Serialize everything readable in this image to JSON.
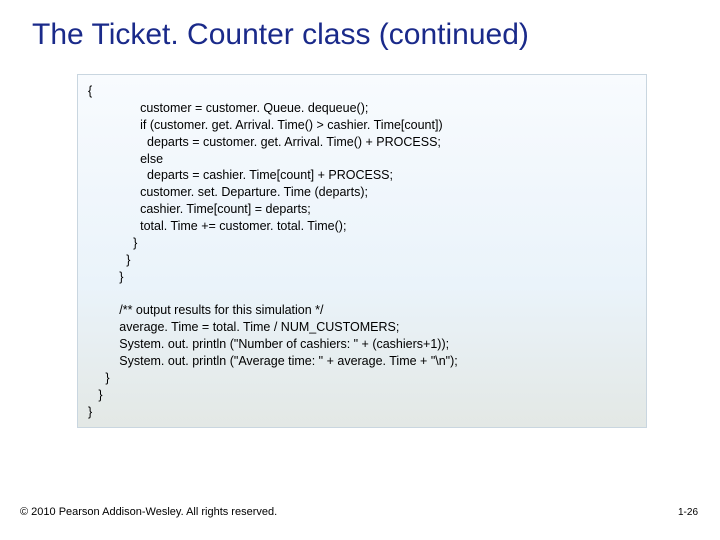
{
  "title": "The Ticket. Counter class (continued)",
  "code": {
    "lines": [
      "{",
      "               customer = customer. Queue. dequeue();",
      "               if (customer. get. Arrival. Time() > cashier. Time[count])",
      "                 departs = customer. get. Arrival. Time() + PROCESS;",
      "               else",
      "                 departs = cashier. Time[count] + PROCESS;",
      "               customer. set. Departure. Time (departs);",
      "               cashier. Time[count] = departs;",
      "               total. Time += customer. total. Time();",
      "             }",
      "           }",
      "         }",
      "",
      "         /** output results for this simulation */",
      "         average. Time = total. Time / NUM_CUSTOMERS;",
      "         System. out. println (\"Number of cashiers: \" + (cashiers+1));",
      "         System. out. println (\"Average time: \" + average. Time + \"\\n\");",
      "     }",
      "   }",
      "}"
    ]
  },
  "footer": {
    "copyright": "© 2010 Pearson Addison-Wesley. All rights reserved.",
    "pagenum": "1-26"
  }
}
